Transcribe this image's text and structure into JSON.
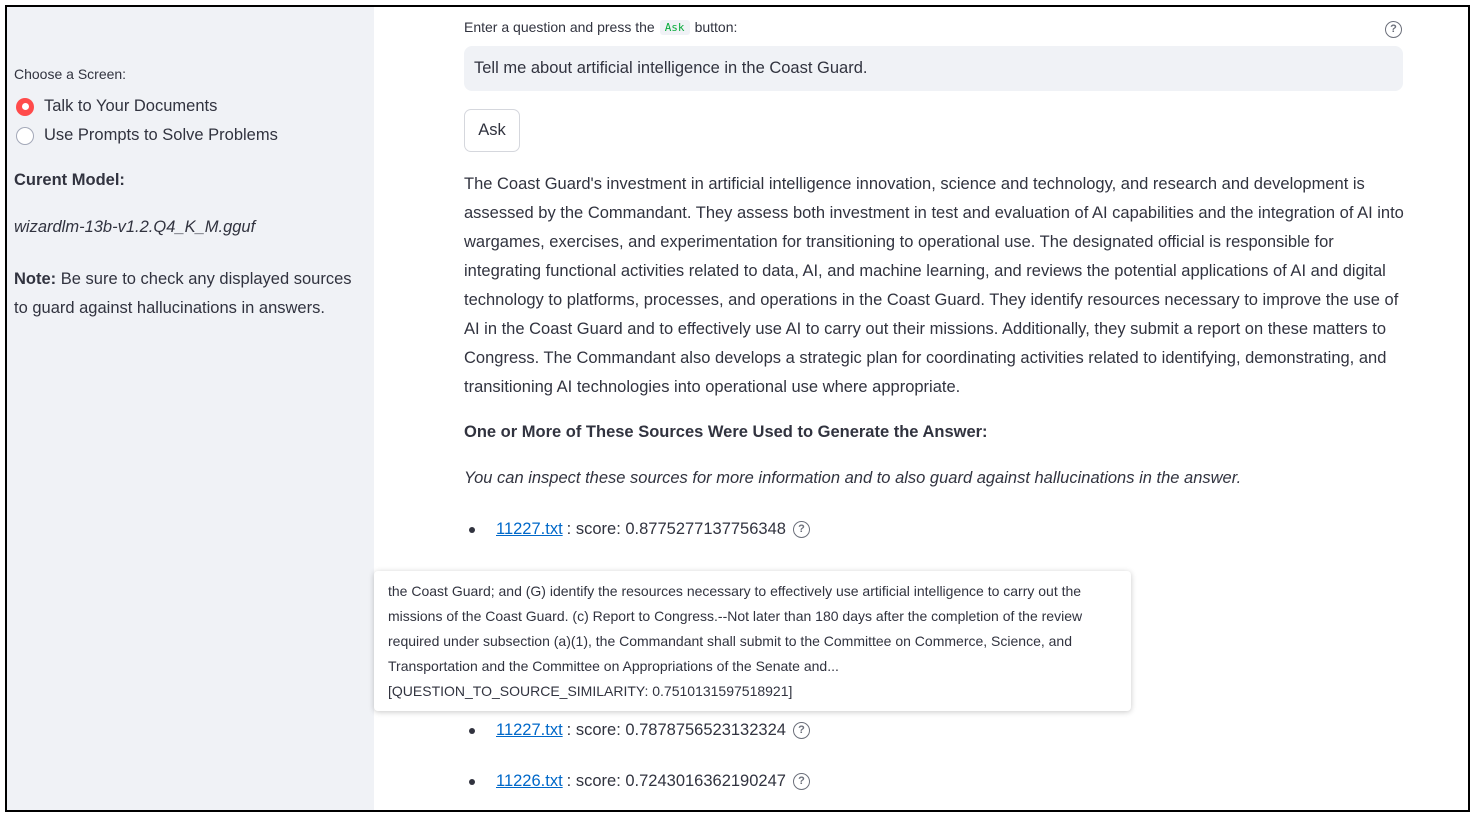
{
  "sidebar": {
    "choose_label": "Choose a Screen:",
    "options": [
      {
        "label": "Talk to Your Documents",
        "selected": true
      },
      {
        "label": "Use Prompts to Solve Problems",
        "selected": false
      }
    ],
    "model_heading": "Curent Model:",
    "model_name": "wizardlm-13b-v1.2.Q4_K_M.gguf",
    "note_label": "Note:",
    "note_text": " Be sure to check any displayed sources to guard against hallucinations in answers."
  },
  "main": {
    "question_label_pre": "Enter a question and press the",
    "question_label_code": "Ask",
    "question_label_post": "button:",
    "question_value": "Tell me about artificial intelligence in the Coast Guard.",
    "ask_label": "Ask",
    "answer": "The Coast Guard's investment in artificial intelligence innovation, science and technology, and research and development is assessed by the Commandant. They assess both investment in test and evaluation of AI capabilities and the integration of AI into wargames, exercises, and experimentation for transitioning to operational use. The designated official is responsible for integrating functional activities related to data, AI, and machine learning, and reviews the potential applications of AI and digital technology to platforms, processes, and operations in the Coast Guard. They identify resources necessary to improve the use of AI in the Coast Guard and to effectively use AI to carry out their missions. Additionally, they submit a report on these matters to Congress. The Commandant also develops a strategic plan for coordinating activities related to identifying, demonstrating, and transitioning AI technologies into operational use where appropriate.",
    "sources_heading": "One or More of These Sources Were Used to Generate the Answer:",
    "sources_subtitle": "You can inspect these sources for more information and to also guard against hallucinations in the answer.",
    "sources": [
      {
        "file": "11227.txt",
        "score": ": score: 0.8775277137756348"
      },
      {
        "file": "11227.txt",
        "score": ": score: 0.7878756523132324"
      },
      {
        "file": "11226.txt",
        "score": ": score: 0.7243016362190247"
      }
    ],
    "tooltip_lines": [
      "the Coast Guard; and (G) identify the resources necessary to effectively use artificial intelligence to carry out the",
      "missions of the Coast Guard. (c) Report to Congress.--Not later than 180 days after the completion of the review",
      "required under subsection (a)(1), the Commandant shall submit to the Committee on Commerce, Science, and",
      "Transportation and the Committee on Appropriations of the Senate and...",
      "[QUESTION_TO_SOURCE_SIMILARITY: 0.7510131597518921]"
    ]
  },
  "colors": {
    "accent": "#ff4b4b",
    "link": "#0068c9",
    "sidebar_bg": "#f0f2f6",
    "code": "#09ab3b"
  }
}
